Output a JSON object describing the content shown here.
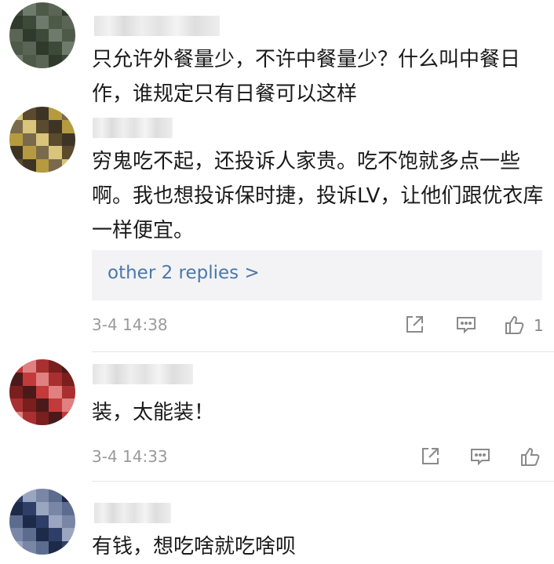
{
  "comments": [
    {
      "text": "只允许外餐量少，不许中餐量少？什么叫中餐日作，谁规定只有日餐可以这样",
      "avatar_palette": [
        "#3d4a3a",
        "#5a6556",
        "#6e7a6b",
        "#2f3a2d",
        "#4e5a48"
      ]
    },
    {
      "text": "穷鬼吃不起，还投诉人家贵。吃不饱就多点一些啊。我也想投诉保时捷，投诉LV，让他们跟优衣库一样便宜。",
      "replies_link": "other 2 replies >",
      "timestamp": "3-4 14:38",
      "like_count": "1",
      "avatar_palette": [
        "#d8c47a",
        "#b69a3e",
        "#5a4a2e",
        "#7a6a4c",
        "#3e3426"
      ]
    },
    {
      "text": "装，太能装！",
      "timestamp": "3-4 14:33",
      "like_count": "",
      "avatar_palette": [
        "#c23a3a",
        "#7a1e1e",
        "#e08080",
        "#4a1a1a",
        "#a83030"
      ]
    },
    {
      "text": "有钱，想吃啥就吃啥呗",
      "avatar_palette": [
        "#2e3e66",
        "#5c6c8e",
        "#9aa6c0",
        "#1e2a4a",
        "#7a86a6"
      ]
    }
  ],
  "icons": [
    "share-icon",
    "comment-icon",
    "like-icon"
  ]
}
